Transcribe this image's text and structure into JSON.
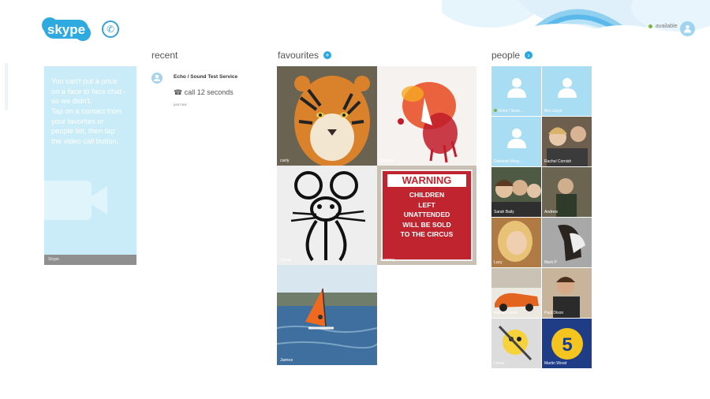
{
  "app": {
    "logo_text": "skype"
  },
  "status": {
    "label": "available",
    "dot_color": "#7cb342"
  },
  "tip": {
    "lines": [
      "You can't put a price",
      "on a face to face chat -",
      "so we didn't.",
      "Tap on a contact from",
      "your favorites or",
      "people list, then tap",
      "the video call button."
    ],
    "footer": "Skype"
  },
  "recent": {
    "heading": "recent",
    "item": {
      "name": "Echo / Sound Test Service",
      "detail": "call 12 seconds",
      "time": "just now"
    }
  },
  "favourites": {
    "heading": "favourites",
    "tiles": [
      {
        "name": "carly"
      },
      {
        "name": "Rachel"
      },
      {
        "name": "David"
      },
      {
        "name": "Sammy",
        "sign_lines": [
          "WARNING",
          "CHILDREN",
          "LEFT",
          "UNATTENDED",
          "WILL BE SOLD",
          "TO THE CIRCUS"
        ]
      },
      {
        "name": "James"
      }
    ]
  },
  "people": {
    "heading": "people",
    "tiles": [
      {
        "name": "Echo / Soun..."
      },
      {
        "name": "Ben Lloyd"
      },
      {
        "name": "Deborah Morg..."
      },
      {
        "name": "Rachel Cornish"
      },
      {
        "name": "Sarah Baily"
      },
      {
        "name": "Andrew"
      },
      {
        "name": "Lucy"
      },
      {
        "name": "Mark P"
      },
      {
        "name": "Nathan Lamb"
      },
      {
        "name": "Paul Dixon"
      },
      {
        "name": "Lorna"
      },
      {
        "name": "Martin Wood"
      }
    ]
  },
  "colors": {
    "accent": "#29a8e0",
    "tile_blue": "#a9ddf3",
    "tip_bg": "#c9ecf8"
  }
}
